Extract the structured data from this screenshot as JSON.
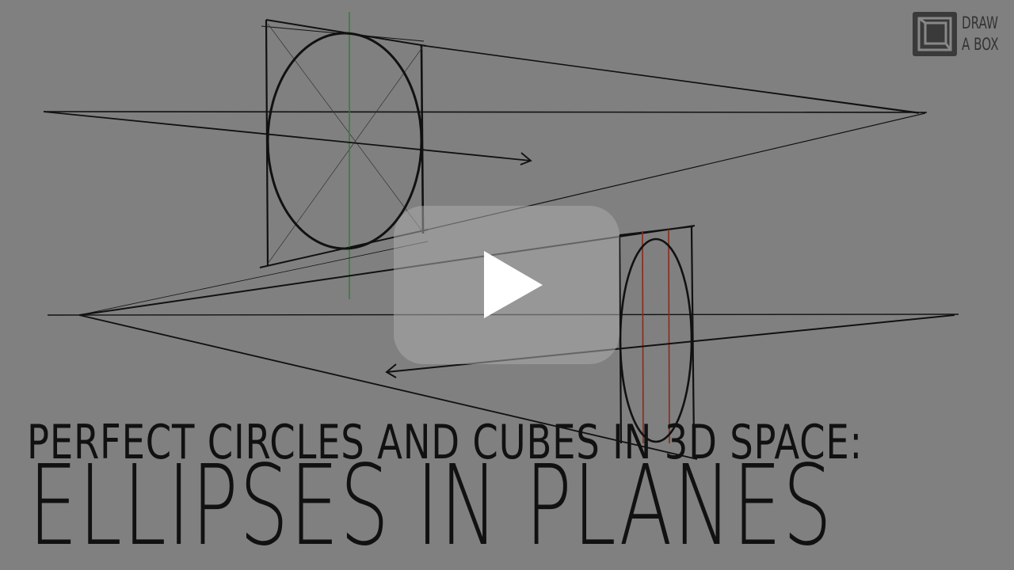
{
  "logo": {
    "line1": "DRAW",
    "line2": "A BOX"
  },
  "title": {
    "subtitle": "PERFECT CIRCLES AND CUBES IN 3D SPACE:",
    "main": "ELLIPSES IN PLANES"
  },
  "play_button": {
    "icon": "play-icon"
  },
  "colors": {
    "background": "#808080",
    "ink": "#111111",
    "green_guide": "#2f7a3a",
    "red_guide": "#8a2a1a",
    "play_overlay": "#aaaaaa"
  }
}
